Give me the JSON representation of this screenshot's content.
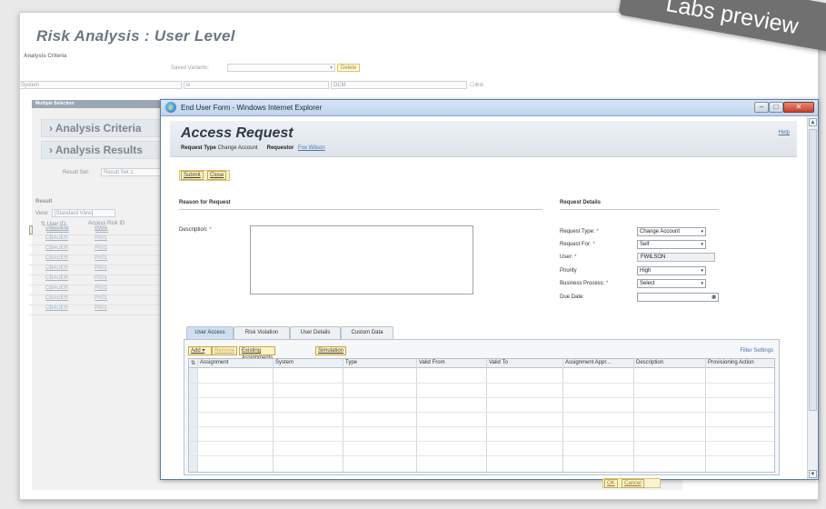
{
  "background": {
    "title": "Risk Analysis : User Level",
    "analysis_criteria_label": "Analysis Criteria",
    "saved_variants_label": "Saved Variants:",
    "delete_label": "Delete",
    "system_field": "System",
    "operator": "is",
    "value": "DCM",
    "multiple_selection_label": "Multiple Selection",
    "nav": [
      "Analysis Criteria",
      "Analysis Results"
    ],
    "result_set_label": "Result Set:",
    "result_set_value": "Result Set 1",
    "result_label": "Result",
    "view_label": "View:",
    "view_value": "[Standard View]",
    "columns": [
      "User ID",
      "Access Risk ID"
    ],
    "rows": [
      [
        "CBAUER",
        "P001"
      ],
      [
        "CBAUER",
        "P001"
      ],
      [
        "CBAUER",
        "P001"
      ],
      [
        "CBAUER",
        "P001"
      ],
      [
        "CBAUER",
        "P001"
      ],
      [
        "CBAUER",
        "P001"
      ],
      [
        "CBAUER",
        "P001"
      ],
      [
        "CBAUER",
        "P001"
      ],
      [
        "CBAUER",
        "P001"
      ],
      [
        "CBAUER",
        "P001"
      ]
    ],
    "ok_label": "OK",
    "cancel_label": "Cancel"
  },
  "watermark": "Labs preview",
  "window": {
    "title": "End User Form - Windows Internet Explorer",
    "minimize": "–",
    "maximize": "□",
    "close": "✕"
  },
  "form": {
    "title": "Access Request",
    "help": "Help",
    "request_type_label": "Request Type",
    "request_type_value": "Change Account",
    "requestor_label": "Requestor",
    "requestor_value": "Fox Wilson",
    "submit": "Submit",
    "close": "Close",
    "reason_header": "Reason for Request",
    "description_label": "Description:",
    "details_header": "Request Details",
    "details": {
      "request_type_label": "Request Type:",
      "request_type_value": "Change Account",
      "request_for_label": "Request For:",
      "request_for_value": "Self",
      "user_label": "User:",
      "user_value": "FWILSON",
      "priority_label": "Priority",
      "priority_value": "High",
      "business_process_label": "Business Process:",
      "business_process_value": "Select",
      "due_date_label": "Due Date:"
    },
    "tabs": [
      "User Access",
      "Risk Violation",
      "User Details",
      "Custom Data"
    ],
    "toolbar": {
      "add": "Add",
      "remove": "Remove",
      "existing": "Existing Assignments",
      "simulation": "Simulation"
    },
    "filter_settings": "Filter Settings",
    "grid_columns": [
      "Assignment",
      "System",
      "Type",
      "Valid From",
      "Valid To",
      "Assignment Appr...",
      "Description",
      "Provisioning Action"
    ]
  }
}
